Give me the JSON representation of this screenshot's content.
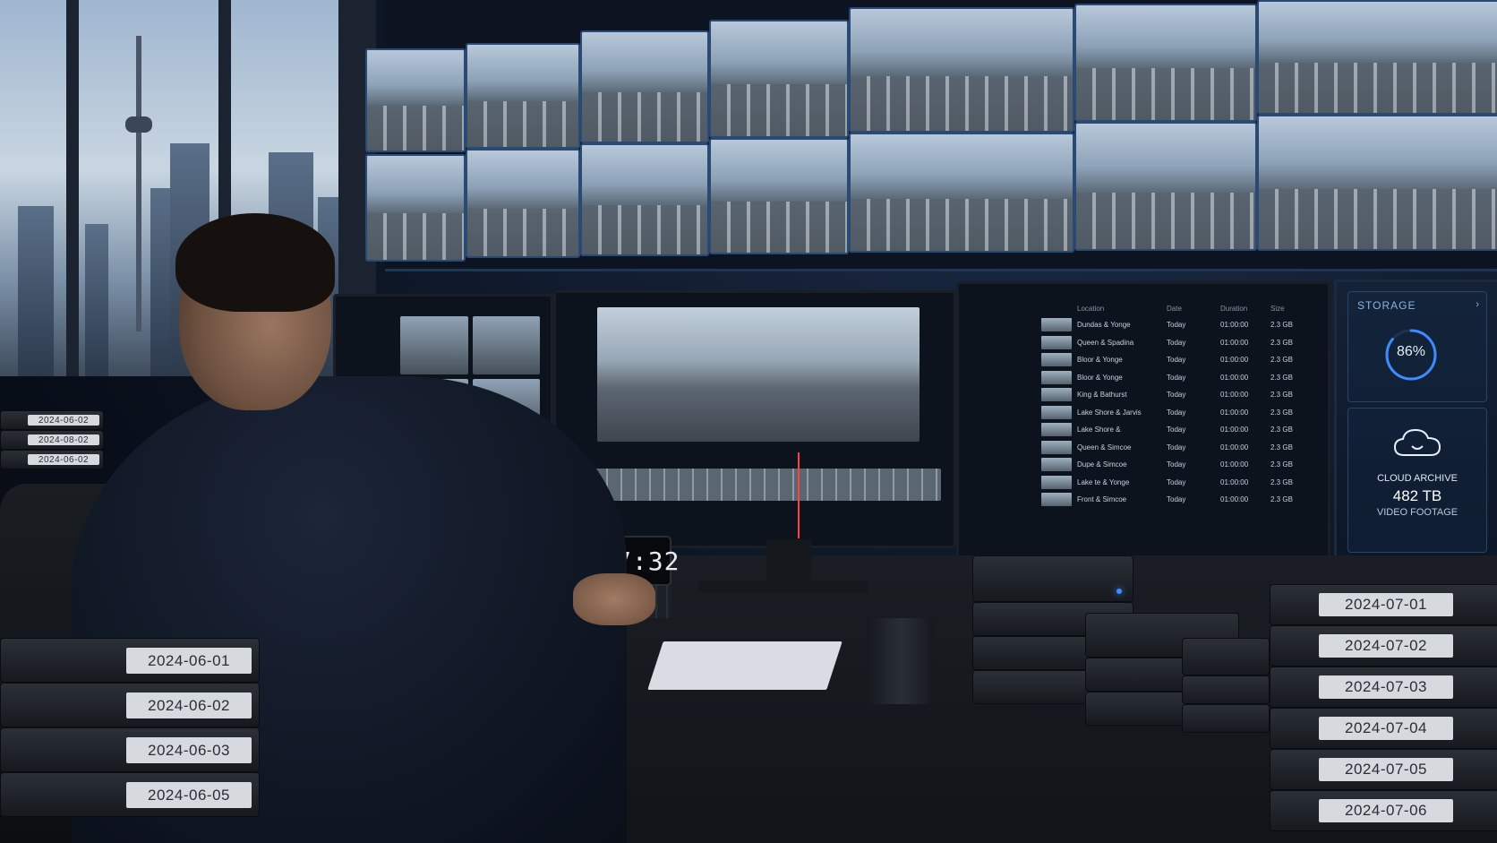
{
  "clock": {
    "time": "15:47:32"
  },
  "file_browser": {
    "headers": [
      "Location",
      "Date",
      "Duration",
      "Size"
    ],
    "rows": [
      {
        "location": "Dundas & Yonge",
        "date": "Today",
        "duration": "01:00:00",
        "size": "2.3 GB"
      },
      {
        "location": "Queen & Spadina",
        "date": "Today",
        "duration": "01:00:00",
        "size": "2.3 GB"
      },
      {
        "location": "Bloor & Yonge",
        "date": "Today",
        "duration": "01:00:00",
        "size": "2.3 GB"
      },
      {
        "location": "Bloor & Yonge",
        "date": "Today",
        "duration": "01:00:00",
        "size": "2.3 GB"
      },
      {
        "location": "King & Bathurst",
        "date": "Today",
        "duration": "01:00:00",
        "size": "2.3 GB"
      },
      {
        "location": "Lake Shore & Jarvis",
        "date": "Today",
        "duration": "01:00:00",
        "size": "2.3 GB"
      },
      {
        "location": "Lake Shore &",
        "date": "Today",
        "duration": "01:00:00",
        "size": "2.3 GB"
      },
      {
        "location": "Queen & Simcoe",
        "date": "Today",
        "duration": "01:00:00",
        "size": "2.3 GB"
      },
      {
        "location": "Dupe & Simcoe",
        "date": "Today",
        "duration": "01:00:00",
        "size": "2.3 GB"
      },
      {
        "location": "Lake te & Yonge",
        "date": "Today",
        "duration": "01:00:00",
        "size": "2.3 GB"
      },
      {
        "location": "Front & Simcoe",
        "date": "Today",
        "duration": "01:00:00",
        "size": "2.3 GB"
      }
    ]
  },
  "storage": {
    "title": "STORAGE",
    "percent_label": "86%",
    "percent": 0.86,
    "archive_line1": "CLOUD ARCHIVE",
    "archive_line2": "482 TB",
    "archive_line3": "VIDEO FOOTAGE"
  },
  "tape_labels_left": [
    "2024-06-01",
    "2024-06-02",
    "2024-06-03",
    "2024-06-05"
  ],
  "tape_labels_right": [
    "2024-07-01",
    "2024-07-02",
    "2024-07-03",
    "2024-07-04",
    "2024-07-05",
    "2024-07-06"
  ],
  "tape_labels_shelf": [
    "2024-06-02",
    "2024-08-02",
    "2024-06-02"
  ],
  "colors": {
    "accent": "#3d8cff",
    "playhead": "#ff4040",
    "wall_border": "#2b4a73"
  },
  "icons": [
    "cloud-icon",
    "chevron-right-icon",
    "storage-ring-icon"
  ]
}
